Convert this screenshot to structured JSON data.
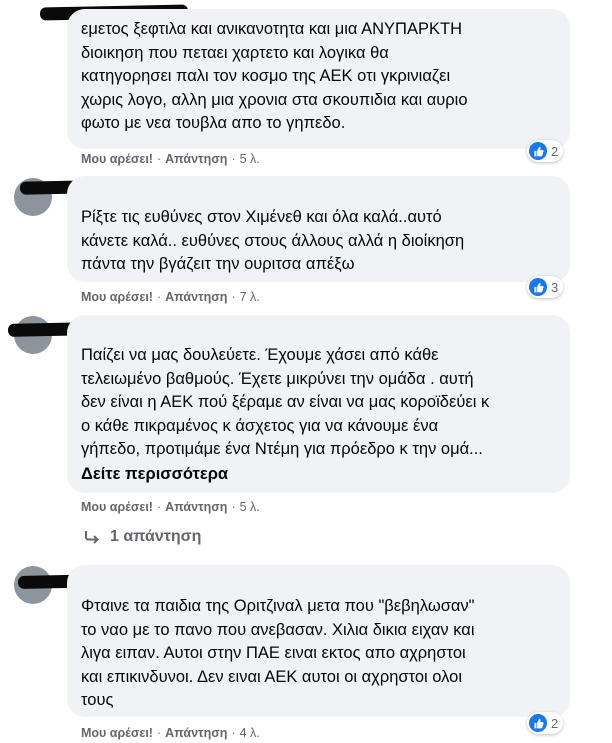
{
  "comments": [
    {
      "text": "εμετος ξεφτιλα και ανικανοτητα και μια ΑΝΥΠΑΡΚΤΗ\nδιοικηση που πεταει χαρτετο και λογικα θα\nκατηγορησει παλι τον κοσμο της ΑΕΚ οτι γκρινιαζει\nχωρις λογο, αλλη μια χρονια στα σκουπιδια και αυριο\nφωτο με νεα τουβλα απο το γηπεδο.",
      "like": "Μου αρέσει!",
      "reply": "Απάντηση",
      "time": "5 λ.",
      "reactions": "2"
    },
    {
      "text": "Ρίξτε τις ευθύνες στον Χιμένεθ και όλα καλά..αυτό\nκάνετε καλά.. ευθύνες στους άλλους αλλά η διοίκηση\nπάντα την βγάζειτ την ουριτσα απέξω",
      "like": "Μου αρέσει!",
      "reply": "Απάντηση",
      "time": "7 λ.",
      "reactions": "3"
    },
    {
      "text": "Παίζει να μας δουλεύετε. Έχουμε χάσει από κάθε\nτελειωμένο βαθμούς. Έχετε μικρύνει την ομάδα . αυτή\nδεν είναι η ΑΕΚ πού ξέραμε αν είναι να μας κοροϊδεύει κ\nο κάθε πικραμένος κ άσχετος για να κάνουμε ένα\nγήπεδο, προτιμάμε ένα Ντέμη για πρόεδρο κ την ομά...",
      "see_more": "Δείτε περισσότερα",
      "like": "Μου αρέσει!",
      "reply": "Απάντηση",
      "time": "5 λ.",
      "replies_link": "1 απάντηση"
    },
    {
      "text": "Φταινε τα παιδια της Οριτζιναλ μετα που \"βεβηλωσαν\"\nτο ναο με το πανο που ανεβασαν. Χιλια δικια ειχαν και\nλιγα ειπαν. Αυτοι στην ΠΑΕ ειναι εκτος απο αχρηστοι\nκαι επικινδυνοι. Δεν ειναι ΑΕΚ αυτοι οι αχρηστοι ολοι\nτους",
      "like": "Μου αρέσει!",
      "reply": "Απάντηση",
      "time": "4 λ.",
      "reactions": "2"
    }
  ],
  "separator": "·",
  "icons": {
    "like": "thumbs-up-icon",
    "reply_arrow": "reply-arrow-icon"
  },
  "colors": {
    "bubble": "#f0f2f5",
    "meta": "#65676b",
    "like_blue": "#1877f2"
  }
}
